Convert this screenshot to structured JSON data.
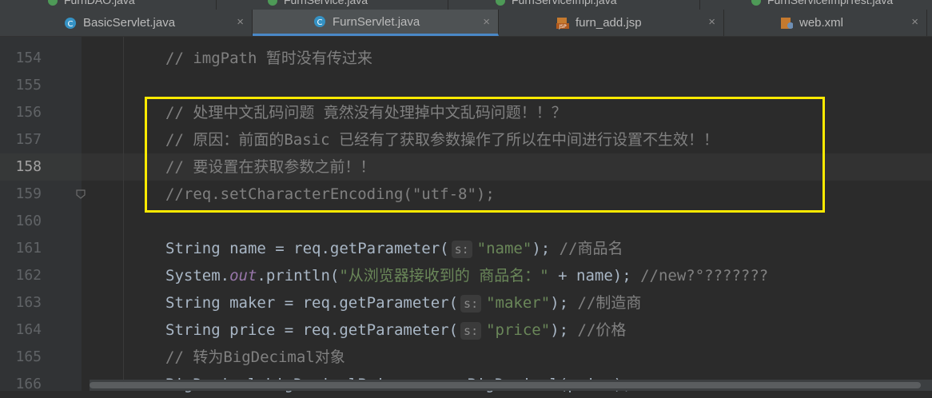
{
  "top_tabs_partial": [
    {
      "label": "FurnDAO.java"
    },
    {
      "label": "FurnService.java"
    },
    {
      "label": "FurnServiceImpl.java"
    },
    {
      "label": "FurnServiceImplTest.java"
    }
  ],
  "tabs": [
    {
      "label": "BasicServlet.java",
      "icon": "java-class-icon",
      "close": "×"
    },
    {
      "label": "FurnServlet.java",
      "icon": "java-class-icon",
      "close": "×",
      "active": true
    },
    {
      "label": "furn_add.jsp",
      "icon": "jsp-file-icon",
      "close": "×"
    },
    {
      "label": "web.xml",
      "icon": "xml-file-icon",
      "close": "×"
    }
  ],
  "line_numbers": [
    "154",
    "155",
    "156",
    "157",
    "158",
    "159",
    "160",
    "161",
    "162",
    "163",
    "164",
    "165",
    "166"
  ],
  "current_line": "158",
  "code": {
    "l154": {
      "comment": "// imgPath 暂时没有传过来"
    },
    "l156": {
      "comment": "// 处理中文乱码问题 竟然没有处理掉中文乱码问题！！？"
    },
    "l157": {
      "comment": "// 原因：前面的Basic 已经有了获取参数操作了所以在中间进行设置不生效！！"
    },
    "l158": {
      "comment": "// 要设置在获取参数之前！！"
    },
    "l159": {
      "comment": "//req.setCharacterEncoding(\"utf-8\");"
    },
    "l161": {
      "pre": "String name = req.getParameter(",
      "hint": "s:",
      "str": "\"name\"",
      "post": "); ",
      "comment": "//商品名"
    },
    "l162": {
      "pre": "System.",
      "field": "out",
      "mid": ".println(",
      "str": "\"从浏览器接收到的 商品名：\"",
      "post": " + name); ",
      "comment": "//new?°???????"
    },
    "l163": {
      "pre": "String maker = req.getParameter(",
      "hint": "s:",
      "str": "\"maker\"",
      "post": "); ",
      "comment": "//制造商"
    },
    "l164": {
      "pre": "String price = req.getParameter(",
      "hint": "s:",
      "str": "\"price\"",
      "post": "); ",
      "comment": "//价格"
    },
    "l165": {
      "comment": "// 转为BigDecimal对象"
    },
    "l166": {
      "pre": "BigDecimal bigDecimalPrice = ",
      "kw": "new",
      "post": " BigDecimal(price);"
    }
  },
  "colors": {
    "editor_bg": "#2b2b2b",
    "comment": "#808080",
    "keyword": "#cc7832",
    "string": "#6a8759",
    "annotation_box": "#ffea00",
    "active_tab_underline": "#4a88c7"
  }
}
